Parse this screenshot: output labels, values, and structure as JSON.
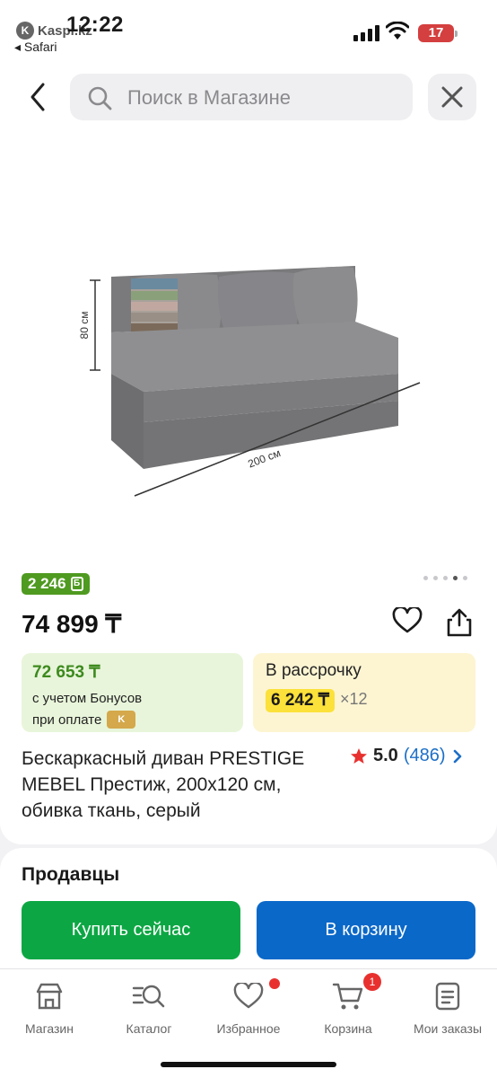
{
  "status_bar": {
    "time": "12:22",
    "back_app_label": "Kaspi.kz",
    "back_app_mark": "K",
    "browser_label": "◂ Safari",
    "battery": "17"
  },
  "search": {
    "placeholder": "Поиск в Магазине"
  },
  "product_image": {
    "height_label": "80 см",
    "width_label": "200 см"
  },
  "gallery": {
    "dots": 5,
    "active_index": 3
  },
  "bonus_badge": {
    "amount": "2 246",
    "icon_glyph": "Б"
  },
  "price": "74 899 ₸",
  "bonus_card": {
    "amount": "72 653 ₸",
    "line1": "с учетом Бонусов",
    "line2": "при оплате"
  },
  "installment_card": {
    "title": "В рассрочку",
    "monthly": "6 242 ₸",
    "times": "×12"
  },
  "product_title": "Бескаркасный диван PRESTIGE MEBEL Престиж, 200x120 см, обивка ткань, серый",
  "rating": {
    "score": "5.0",
    "count": "(486)"
  },
  "sellers_heading": "Продавцы",
  "buttons": {
    "buy_now": "Купить сейчас",
    "add_to_cart": "В корзину"
  },
  "tabbar": {
    "items": [
      {
        "label": "Магазин",
        "icon": "shop-icon"
      },
      {
        "label": "Каталог",
        "icon": "catalog-search-icon"
      },
      {
        "label": "Избранное",
        "icon": "heart-icon",
        "dot": true
      },
      {
        "label": "Корзина",
        "icon": "cart-icon",
        "badge": "1"
      },
      {
        "label": "Мои заказы",
        "icon": "orders-icon"
      }
    ]
  },
  "colors": {
    "green_button": "#0ca744",
    "blue_button": "#0a68c9",
    "bonus_green": "#4f9a21",
    "installment_yellow": "#fbe13a",
    "rating_star": "#e8312f"
  }
}
